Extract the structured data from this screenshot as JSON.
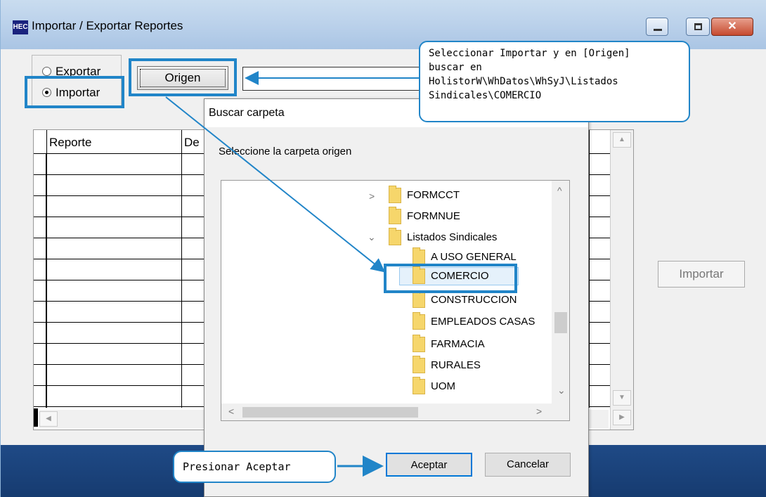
{
  "window": {
    "title": "Importar / Exportar Reportes",
    "icon_label": "HEC",
    "close_glyph": "✕"
  },
  "radio": {
    "exportar": "Exportar",
    "importar": "Importar",
    "selected": "importar"
  },
  "origen_button": "Origen",
  "path_value": "",
  "grid": {
    "columns": [
      "Reporte",
      "De"
    ],
    "rows_visible": 12
  },
  "importar_button": "Importar",
  "dialog": {
    "title": "Buscar carpeta",
    "prompt": "Seleccione la carpeta origen",
    "tree": [
      {
        "label": "FORMCCT",
        "level": 0,
        "expander": "collapsed"
      },
      {
        "label": "FORMNUE",
        "level": 0,
        "expander": "none"
      },
      {
        "label": "Listados Sindicales",
        "level": 0,
        "expander": "expanded"
      },
      {
        "label": "A  USO GENERAL",
        "level": 1,
        "expander": "none"
      },
      {
        "label": "COMERCIO",
        "level": 1,
        "expander": "none",
        "selected": true
      },
      {
        "label": "CONSTRUCCION",
        "level": 1,
        "expander": "none"
      },
      {
        "label": "EMPLEADOS CASAS",
        "level": 1,
        "expander": "none"
      },
      {
        "label": "FARMACIA",
        "level": 1,
        "expander": "none"
      },
      {
        "label": "RURALES",
        "level": 1,
        "expander": "none"
      },
      {
        "label": "UOM",
        "level": 1,
        "expander": "none"
      }
    ],
    "ok_button": "Aceptar",
    "cancel_button": "Cancelar"
  },
  "callouts": {
    "top_lines": [
      "Seleccionar Importar y en [Origen]",
      "buscar en",
      "HolistorW\\WhDatos\\WhSyJ\\Listados",
      "Sindicales\\COMERCIO"
    ],
    "bottom": "Presionar Aceptar"
  },
  "colors": {
    "highlight": "#2185c8",
    "bottom_band": "#1f4a86",
    "folder": "#f6d66b"
  }
}
